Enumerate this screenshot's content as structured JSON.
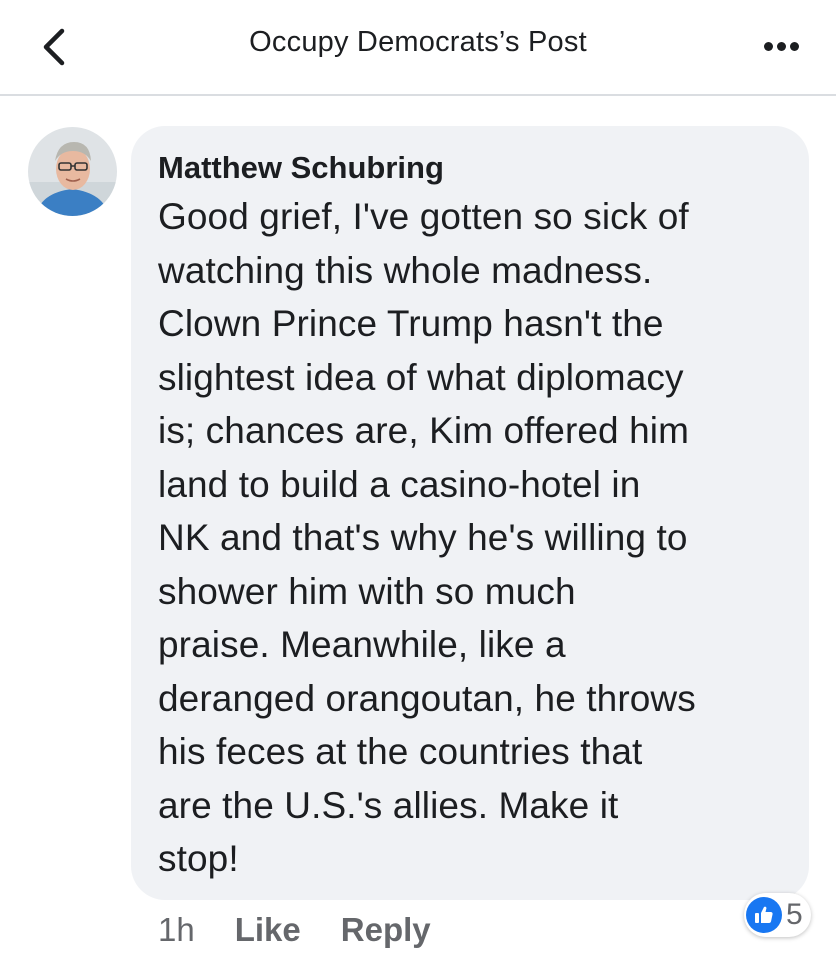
{
  "header": {
    "title": "Occupy Democrats’s Post",
    "back_icon": "chevron-left-icon",
    "more_icon": "more-horizontal-icon"
  },
  "comment": {
    "author": "Matthew Schubring",
    "text": "Good grief, I've gotten so sick of\nwatching this whole madness.\nClown Prince Trump hasn't the\nslightest idea of what diplomacy\nis; chances are, Kim offered him\nland to build a casino-hotel in\nNK and that's why he's willing to\nshower him with so much\npraise.  Meanwhile, like a\nderanged orangoutan, he throws\nhis feces at the countries that\nare the U.S.'s allies.   Make it\nstop!",
    "time": "1h",
    "like_label": "Like",
    "reply_label": "Reply",
    "reaction_count": "5",
    "reaction_icon": "like-thumb-icon"
  },
  "colors": {
    "bubble_bg": "#f0f2f5",
    "accent_blue": "#1877f2",
    "secondary_text": "#65676b"
  }
}
